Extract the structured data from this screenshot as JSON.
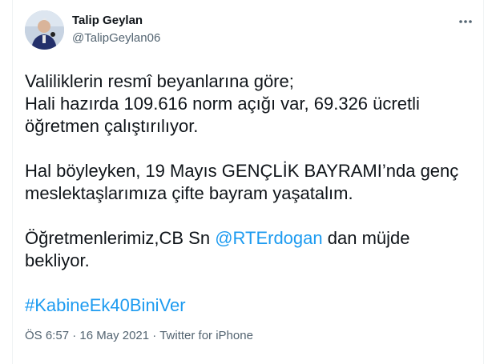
{
  "author": {
    "name": "Talip Geylan",
    "handle": "@TalipGeylan06"
  },
  "more_menu": {
    "icon": "more-horizontal-icon"
  },
  "tweet": {
    "line1": "Valiliklerin resmî beyanlarına göre;",
    "line2": "Hali hazırda 109.616 norm açığı var, 69.326 ücretli",
    "line3": "öğretmen çalıştırılıyor.",
    "line4": "Hal böyleyken, 19 Mayıs GENÇLİK BAYRAMI’nda genç",
    "line5": "meslektaşlarımıza çifte bayram yaşatalım.",
    "line6_prefix": "Öğretmenlerimiz,CB Sn ",
    "mention": "@RTErdogan",
    "line6_suffix": " dan müjde",
    "line7": "bekliyor.",
    "hashtag": "#KabineEk40BiniVer"
  },
  "meta": {
    "time": "ÖS 6:57",
    "separator1": " · ",
    "date": "16 May 2021",
    "separator2": " · ",
    "source": "Twitter for iPhone"
  },
  "colors": {
    "link": "#1d9bf0",
    "text": "#0f1419",
    "secondary": "#536471"
  }
}
